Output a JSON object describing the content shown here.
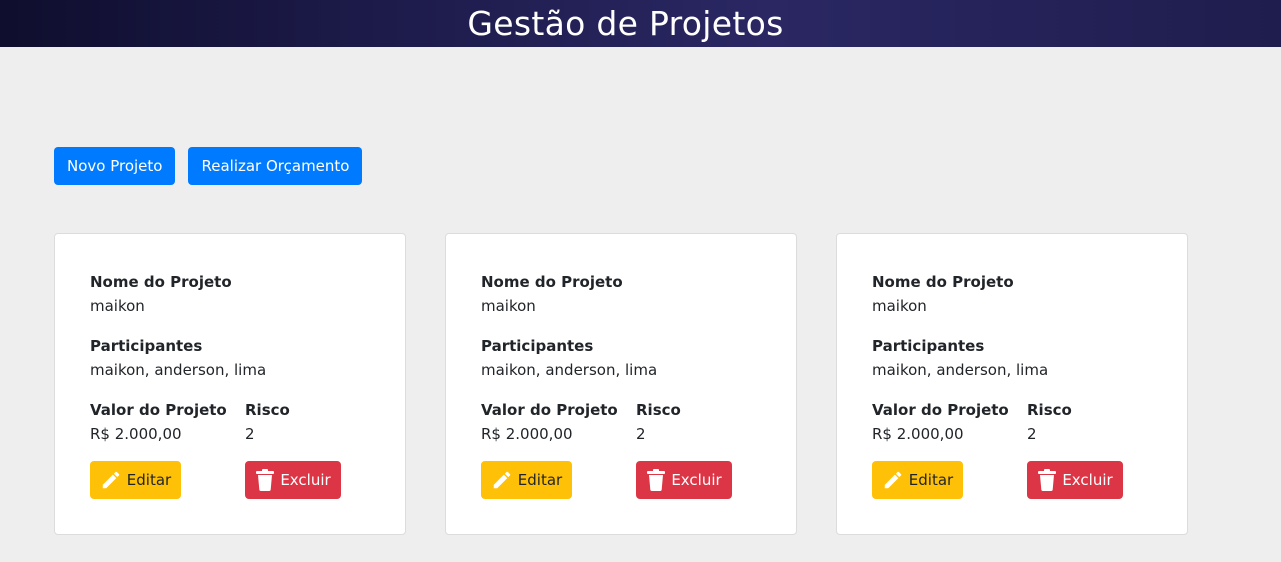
{
  "header": {
    "title": "Gestão de Projetos"
  },
  "toolbar": {
    "new_project_label": "Novo Projeto",
    "budget_label": "Realizar Orçamento"
  },
  "labels": {
    "project_name": "Nome do Projeto",
    "participants": "Participantes",
    "project_value": "Valor do Projeto",
    "risk": "Risco",
    "edit": "Editar",
    "delete": "Excluir"
  },
  "icons": {
    "edit": "pencil-icon",
    "delete": "trash-icon"
  },
  "colors": {
    "primary": "#007bff",
    "warning": "#ffc107",
    "danger": "#dc3545"
  },
  "projects": [
    {
      "name": "maikon",
      "participants": "maikon, anderson, lima",
      "value": "R$ 2.000,00",
      "risk": "2"
    },
    {
      "name": "maikon",
      "participants": "maikon, anderson, lima",
      "value": "R$ 2.000,00",
      "risk": "2"
    },
    {
      "name": "maikon",
      "participants": "maikon, anderson, lima",
      "value": "R$ 2.000,00",
      "risk": "2"
    }
  ]
}
